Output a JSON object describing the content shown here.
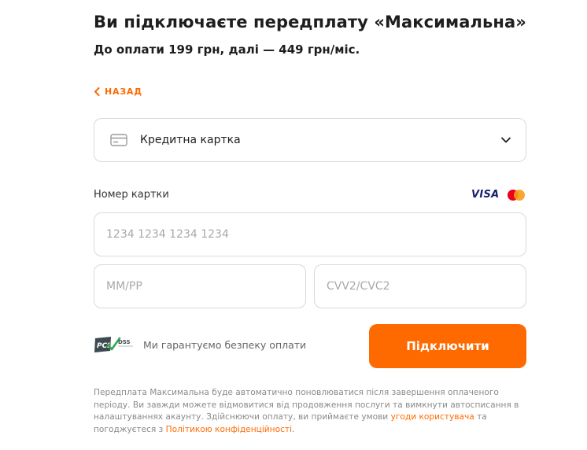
{
  "header": {
    "title": "Ви підключаєте передплату «Максимальна»",
    "subtitle": "До оплати 199 грн, далі — 449 грн/міс."
  },
  "back": {
    "label": "НАЗАД"
  },
  "payment_method": {
    "selected": "Кредитна картка",
    "icon": "credit-card-icon"
  },
  "card_form": {
    "card_number_label": "Номер картки",
    "card_number_placeholder": "1234 1234 1234 1234",
    "expiry_placeholder": "ММ/РР",
    "cvv_placeholder": "CVV2/CVC2",
    "brands": [
      "VISA",
      "mastercard"
    ]
  },
  "security": {
    "badge_text": "DSS",
    "text": "Ми гарантуємо безпеку оплати"
  },
  "submit": {
    "label": "Підключити"
  },
  "disclaimer": {
    "text_1": "Передплата Максимальна буде автоматично поновлюватися після завершення оплаченого періоду. Ви завжди можете відмовитися від продовження послуги та вимкнути автосписання в налаштуваннях акаунту. Здійснюючи оплату, ви приймаєте умови ",
    "link_1": "угоди користувача",
    "text_2": " та погоджуєтеся з ",
    "link_2": "Політикою конфіденційності",
    "text_3": "."
  },
  "colors": {
    "accent": "#ff6a00",
    "border": "#d9d9d9",
    "visa": "#1a1f71"
  }
}
